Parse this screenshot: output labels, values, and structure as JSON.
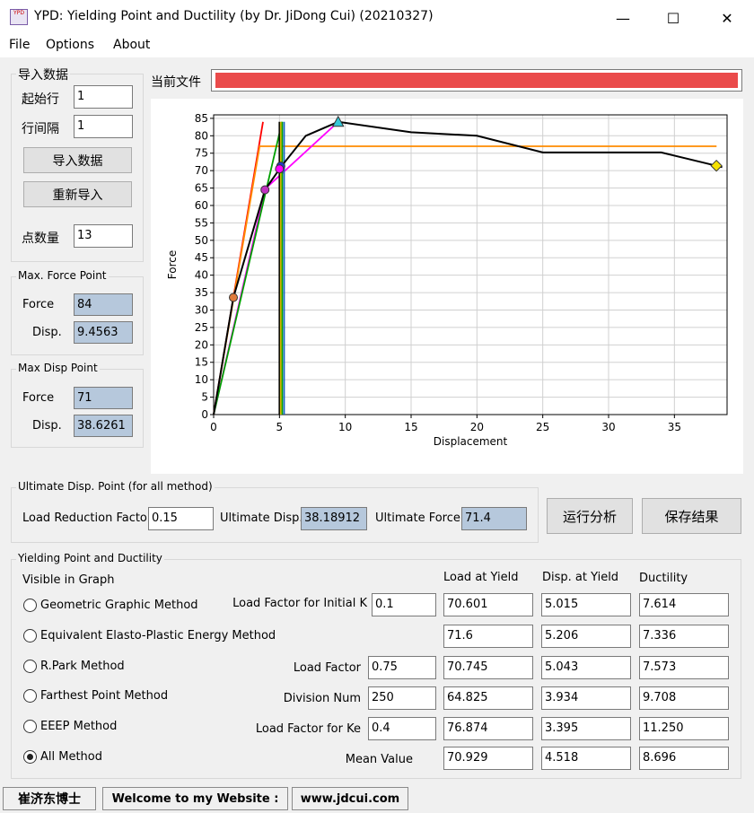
{
  "window": {
    "title": "YPD: Yielding Point and Ductility (by Dr. JiDong Cui) (20210327)",
    "icon_text": "YPD",
    "minimize_icon": "—",
    "maximize_icon": "☐",
    "close_icon": "✕"
  },
  "menu": [
    "File",
    "Options",
    "About"
  ],
  "import_panel": {
    "title": "导入数据",
    "start_row_label": "起始行",
    "start_row_value": "1",
    "row_interval_label": "行间隔",
    "row_interval_value": "1",
    "import_button": "导入数据",
    "reimport_button": "重新导入",
    "point_count_label": "点数量",
    "point_count_value": "13"
  },
  "max_force_panel": {
    "title": "Max. Force Point",
    "force_label": "Force",
    "force_value": "84",
    "disp_label": "Disp.",
    "disp_value": "9.4563"
  },
  "max_disp_panel": {
    "title": "Max Disp Point",
    "force_label": "Force",
    "force_value": "71",
    "disp_label": "Disp.",
    "disp_value": "38.6261"
  },
  "current_file": {
    "label": "当前文件",
    "bar_color": "#ea4b4b"
  },
  "ultimate_panel": {
    "title": "Ultimate Disp. Point (for all method)",
    "reduction_label": "Load Reduction Factor",
    "reduction_value": "0.15",
    "ult_disp_label": "Ultimate Disp.",
    "ult_disp_value": "38.18912",
    "ult_force_label": "Ultimate Force",
    "ult_force_value": "71.4"
  },
  "actions": {
    "run_button": "运行分析",
    "save_button": "保存结果"
  },
  "yield_panel": {
    "title": "Yielding Point and Ductility",
    "visible_label": "Visible in Graph",
    "col_load": "Load at Yield",
    "col_disp": "Disp. at Yield",
    "col_ductility": "Ductility",
    "methods": [
      {
        "name": "Geometric Graphic Method",
        "param_label": "Load Factor for Initial K",
        "param_value": "0.1",
        "load": "70.601",
        "disp": "5.015",
        "ductility": "7.614",
        "selected": false
      },
      {
        "name": "Equivalent Elasto-Plastic Energy Method",
        "param_label": "",
        "param_value": "",
        "load": "71.6",
        "disp": "5.206",
        "ductility": "7.336",
        "selected": false
      },
      {
        "name": "R.Park Method",
        "param_label": "Load Factor",
        "param_value": "0.75",
        "load": "70.745",
        "disp": "5.043",
        "ductility": "7.573",
        "selected": false
      },
      {
        "name": "Farthest Point Method",
        "param_label": "Division Num",
        "param_value": "250",
        "load": "64.825",
        "disp": "3.934",
        "ductility": "9.708",
        "selected": false
      },
      {
        "name": "EEEP Method",
        "param_label": "Load Factor for Ke",
        "param_value": "0.4",
        "load": "76.874",
        "disp": "3.395",
        "ductility": "11.250",
        "selected": false
      },
      {
        "name": "All Method",
        "param_label": "",
        "param_value": "",
        "load": "",
        "disp": "",
        "ductility": "",
        "selected": true
      }
    ],
    "mean": {
      "label": "Mean Value",
      "load": "70.929",
      "disp": "4.518",
      "ductility": "8.696"
    }
  },
  "statusbar": {
    "author": "崔济东博士",
    "welcome": "Welcome to my Website :",
    "website": "www.jdcui.com"
  },
  "chart_data": {
    "type": "line",
    "xlabel": "Displacement",
    "ylabel": "Force",
    "xlim": [
      0,
      39
    ],
    "ylim": [
      0,
      86
    ],
    "xticks": [
      0,
      5,
      10,
      15,
      20,
      25,
      30,
      35
    ],
    "yticks": [
      0,
      5,
      10,
      15,
      20,
      25,
      30,
      35,
      40,
      45,
      50,
      55,
      60,
      65,
      70,
      75,
      80,
      85
    ],
    "grid": true,
    "series": [
      {
        "color": "#000000",
        "points": [
          [
            0,
            0
          ],
          [
            1.5,
            33.6
          ],
          [
            3.9,
            64.5
          ],
          [
            5.2,
            71.5
          ],
          [
            7,
            80
          ],
          [
            9.46,
            84
          ],
          [
            15,
            81
          ],
          [
            20,
            80
          ],
          [
            25,
            75.2
          ],
          [
            30,
            75.2
          ],
          [
            34,
            75.2
          ],
          [
            38.63,
            71
          ]
        ]
      },
      {
        "color": "#ff0000",
        "points": [
          [
            0,
            0
          ],
          [
            3.75,
            84
          ]
        ]
      },
      {
        "color": "#ff8c00",
        "points": [
          [
            0,
            0
          ],
          [
            3.5,
            77
          ],
          [
            38.2,
            77
          ]
        ]
      },
      {
        "color": "#ff00ff",
        "points": [
          [
            0,
            0
          ],
          [
            3.93,
            64.8
          ],
          [
            9.46,
            84
          ]
        ]
      },
      {
        "color": "#00a000",
        "points": [
          [
            0,
            0
          ],
          [
            5.2,
            84
          ]
        ]
      },
      {
        "color": "#00a000",
        "points": [
          [
            5.2,
            0
          ],
          [
            5.2,
            84
          ]
        ]
      },
      {
        "color": "#000000",
        "points": [
          [
            5.0,
            0
          ],
          [
            5.0,
            84
          ]
        ]
      },
      {
        "color": "#1565c0",
        "points": [
          [
            5.35,
            0
          ],
          [
            5.35,
            84
          ]
        ]
      },
      {
        "color": "#d4b800",
        "points": [
          [
            5.1,
            0
          ],
          [
            5.1,
            84
          ]
        ]
      }
    ],
    "markers": [
      {
        "x": 1.5,
        "y": 33.6,
        "shape": "circle",
        "color": "#e07a3c"
      },
      {
        "x": 3.9,
        "y": 64.5,
        "shape": "circle",
        "color": "#c032c0"
      },
      {
        "x": 5.1,
        "y": 71.3,
        "shape": "circle",
        "color": "#1e3cc8"
      },
      {
        "x": 5.0,
        "y": 70.5,
        "shape": "circle",
        "color": "#ff00ff"
      },
      {
        "x": 9.46,
        "y": 84,
        "shape": "triangle",
        "color": "#36c8d8"
      },
      {
        "x": 38.19,
        "y": 71.4,
        "shape": "diamond",
        "color": "#f5e100"
      }
    ]
  }
}
